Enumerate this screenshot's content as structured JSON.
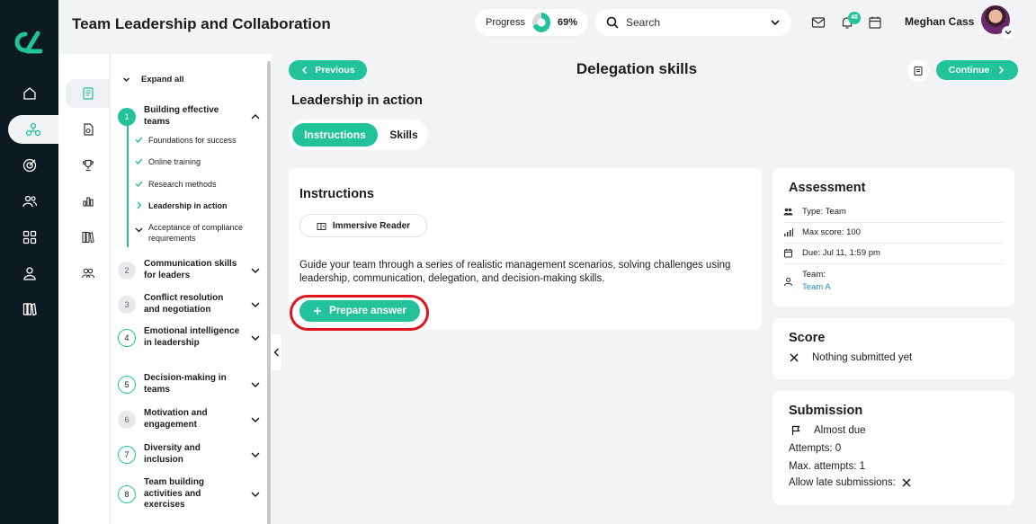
{
  "app": {
    "title": "Team Leadership and Collaboration",
    "accent_color": "#22c39b",
    "logo_icon": "brand-logo-icon"
  },
  "leftbar": {
    "items": [
      {
        "icon": "home-icon"
      },
      {
        "icon": "network-icon",
        "active": true
      },
      {
        "icon": "target-icon"
      },
      {
        "icon": "users-icon"
      },
      {
        "icon": "grid-icon"
      },
      {
        "icon": "user-icon"
      },
      {
        "icon": "library-icon"
      }
    ]
  },
  "header": {
    "progress_label": "Progress",
    "progress_value": 69,
    "progress_text": "69%",
    "search_placeholder": "Search",
    "notification_count": "48",
    "user_name": "Meghan Cass"
  },
  "toc": {
    "expand_all": "Expand all",
    "icons": [
      "book-icon",
      "document-icon",
      "trophy-icon",
      "bar-chart-icon",
      "library-icon",
      "group-icon"
    ],
    "modules": [
      {
        "num": "1",
        "name": "Building effective teams",
        "state": "active",
        "expanded": true
      },
      {
        "num": "2",
        "name": "Communication skills for leaders",
        "state": "gray"
      },
      {
        "num": "3",
        "name": "Conflict resolution and negotiation",
        "state": "gray"
      },
      {
        "num": "4",
        "name": "Emotional intelligence in leadership",
        "state": "outline"
      },
      {
        "num": "5",
        "name": "Decision-making in teams",
        "state": "outline"
      },
      {
        "num": "6",
        "name": "Motivation and engagement",
        "state": "gray"
      },
      {
        "num": "7",
        "name": "Diversity and inclusion",
        "state": "outline"
      },
      {
        "num": "8",
        "name": "Team building activities and exercises",
        "state": "outline"
      }
    ],
    "lessons": [
      {
        "label": "Foundations for success",
        "status": "done"
      },
      {
        "label": "Online training",
        "status": "done"
      },
      {
        "label": "Research methods",
        "status": "done"
      },
      {
        "label": "Leadership in action",
        "status": "current"
      },
      {
        "label": "Acceptance of compliance requirements",
        "status": "partial"
      }
    ]
  },
  "content": {
    "previous_label": "Previous",
    "continue_label": "Continue",
    "page_title": "Delegation skills",
    "section_title": "Leadership in action",
    "tabs": [
      {
        "label": "Instructions",
        "active": true
      },
      {
        "label": "Skills",
        "active": false
      }
    ],
    "instructions": {
      "heading": "Instructions",
      "immersive_reader": "Immersive Reader",
      "description": "Guide your team through a series of realistic management scenarios, solving challenges using leadership, communication, delegation, and decision-making skills.",
      "prepare_answer": "Prepare answer"
    }
  },
  "assessment": {
    "heading": "Assessment",
    "type": "Type: Team",
    "max_score": "Max score: 100",
    "due": "Due: Jul 11, 1:59 pm",
    "team_label": "Team:",
    "team_value": "Team A"
  },
  "score": {
    "heading": "Score",
    "status": "Nothing submitted yet"
  },
  "submission": {
    "heading": "Submission",
    "due_status": "Almost due",
    "attempts": "Attempts: 0",
    "max_attempts": "Max. attempts: 1",
    "late": "Allow late submissions:"
  }
}
